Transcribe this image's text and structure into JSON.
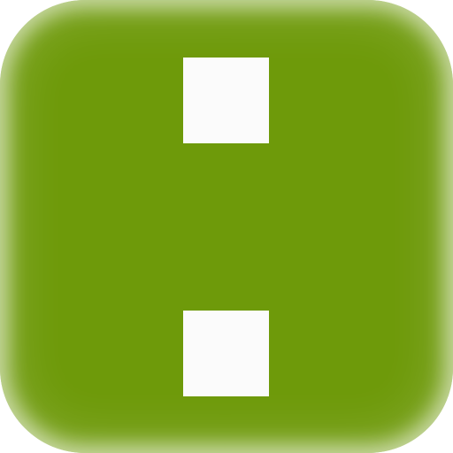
{
  "icon": {
    "name": "colon-glyph-icon",
    "background_color": "#6e9a0a",
    "glyph_color": "#fbfbfb",
    "glyph_parts": [
      "top-square",
      "bottom-square"
    ]
  }
}
